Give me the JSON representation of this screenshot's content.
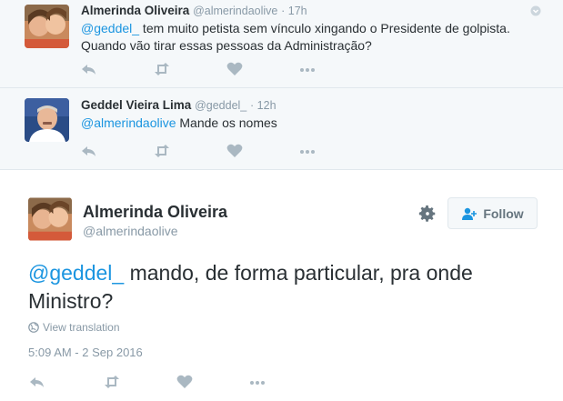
{
  "replies": [
    {
      "fullname": "Almerinda Oliveira",
      "handle": "@almerindaolive",
      "time": "· 17h",
      "mention": "@geddel_",
      "text": " tem muito petista sem vínculo xingando o Presidente de golpista. Quando vão tirar essas pessoas da Administração?"
    },
    {
      "fullname": "Geddel Vieira Lima",
      "handle": "@geddel_",
      "time": "· 12h",
      "mention": "@almerindaolive",
      "text": " Mande os nomes"
    }
  ],
  "main": {
    "fullname": "Almerinda Oliveira",
    "handle": "@almerindaolive",
    "follow_label": "Follow",
    "mention": "@geddel_",
    "text": " mando, de forma particular, pra onde Ministro?",
    "translate": "View translation",
    "timestamp": "5:09 AM - 2 Sep 2016"
  },
  "colors": {
    "link": "#1b95e0",
    "muted": "#8899a6",
    "icon": "#aab8c2",
    "reply_bg": "#f5f8fa"
  }
}
